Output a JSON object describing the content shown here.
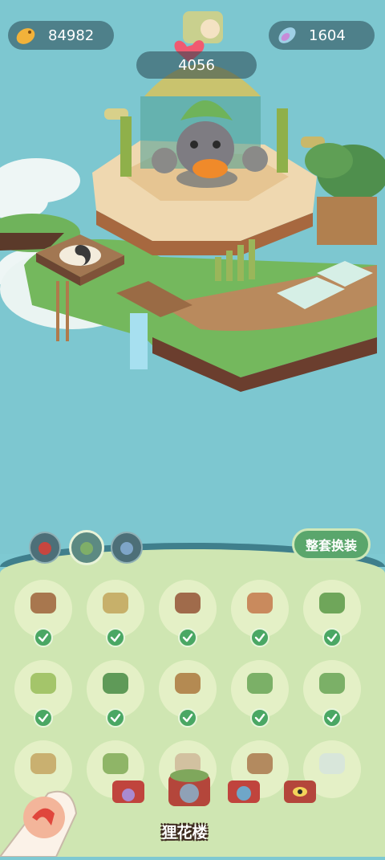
{
  "currency": {
    "coins": "84982",
    "gems": "1604"
  },
  "hearts": "4056",
  "outfit_button_label": "整套换装",
  "location_name": "狸花楼",
  "tabs": [
    {
      "name": "red-cat-tab",
      "color": "#c7463f"
    },
    {
      "name": "green-cat-tab",
      "color": "#7fae68"
    },
    {
      "name": "blue-cat-tab",
      "color": "#7ea5c8"
    }
  ],
  "items": [
    {
      "name": "wooden-dock",
      "owned": true
    },
    {
      "name": "bamboo-gate",
      "owned": true
    },
    {
      "name": "wood-steps",
      "owned": true
    },
    {
      "name": "leaf-mat",
      "owned": true
    },
    {
      "name": "bonsai-tree",
      "owned": true
    },
    {
      "name": "flag-banner",
      "owned": true
    },
    {
      "name": "bush-cluster",
      "owned": true
    },
    {
      "name": "rope-bridge",
      "owned": true
    },
    {
      "name": "clover-small",
      "owned": true
    },
    {
      "name": "clover-leaf",
      "owned": true
    },
    {
      "name": "tree-planter",
      "owned": true
    },
    {
      "name": "bush-garden",
      "owned": true
    },
    {
      "name": "shrine-base",
      "owned": true
    },
    {
      "name": "shelf",
      "owned": true
    },
    {
      "name": "crates",
      "owned": true
    }
  ],
  "colors": {
    "sky": "#7dc7d0",
    "panel": "#cfe6b2",
    "accent_green": "#5aa66c",
    "check_green": "#4aa764"
  }
}
